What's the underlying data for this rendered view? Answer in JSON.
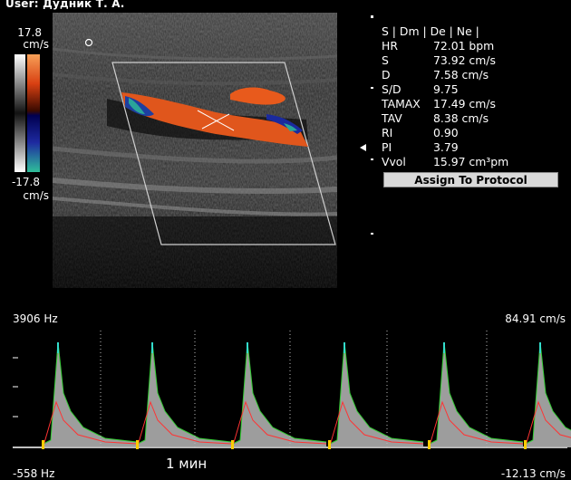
{
  "header": {
    "user": "User: Дудник Т. А."
  },
  "color_scale": {
    "top": "17.8",
    "top_unit": "cm/s",
    "bottom": "-17.8",
    "bottom_unit": "cm/s"
  },
  "measurements": {
    "modes": "S | Dm | De | Ne |",
    "rows": [
      {
        "key": "HR",
        "value": "72.01 bpm"
      },
      {
        "key": "S",
        "value": "73.92 cm/s"
      },
      {
        "key": "D",
        "value": "7.58 cm/s"
      },
      {
        "key": "S/D",
        "value": "9.75"
      },
      {
        "key": "TAMAX",
        "value": "17.49 cm/s"
      },
      {
        "key": "TAV",
        "value": "8.38 cm/s"
      },
      {
        "key": "RI",
        "value": "0.90"
      },
      {
        "key": "PI",
        "value": "3.79"
      },
      {
        "key": "Vvol",
        "value": "15.97 cm³pm"
      }
    ],
    "assign_button": "Assign To Protocol"
  },
  "doppler": {
    "prf_top": "3906 Hz",
    "prf_bottom": "-558 Hz",
    "vel_top": "84.91 cm/s",
    "vel_bottom": "-12.13 cm/s",
    "time_marker": "1 мин"
  },
  "colors": {
    "flow_red": "#e85a1c",
    "flow_blue": "#1a2a9e",
    "flow_cyan": "#2aa59a",
    "spectrum_green": "#33cc33",
    "spectrum_red": "#ff3333"
  }
}
